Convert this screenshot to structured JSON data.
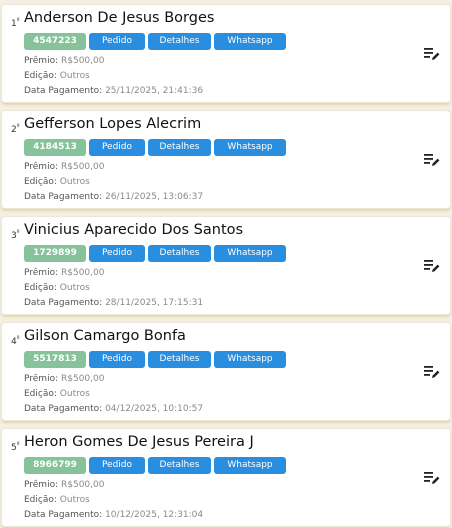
{
  "labels": {
    "premio": "Prêmio:",
    "edicao": "Edição:",
    "data_pagamento": "Data Pagamento:",
    "pedido": "Pedido",
    "detalhes": "Detalhes",
    "whatsapp": "Whatsapp"
  },
  "colors": {
    "id_chip": "#86c29a",
    "action_button": "#2a8ee0",
    "card_shadow": "#e8d9a8"
  },
  "winners": [
    {
      "rank": "1",
      "rank_suffix": "º",
      "name": "Anderson De Jesus Borges",
      "id": "4547223",
      "premio": "R$500,00",
      "edicao": "Outros",
      "data_pagamento": "25/11/2025, 21:41:36"
    },
    {
      "rank": "2",
      "rank_suffix": "º",
      "name": "Gefferson Lopes Alecrim",
      "id": "4184513",
      "premio": "R$500,00",
      "edicao": "Outros",
      "data_pagamento": "26/11/2025, 13:06:37"
    },
    {
      "rank": "3",
      "rank_suffix": "º",
      "name": "Vinicius Aparecido Dos Santos",
      "id": "1729899",
      "premio": "R$500,00",
      "edicao": "Outros",
      "data_pagamento": "28/11/2025, 17:15:31"
    },
    {
      "rank": "4",
      "rank_suffix": "º",
      "name": "Gilson Camargo Bonfa",
      "id": "5517813",
      "premio": "R$500,00",
      "edicao": "Outros",
      "data_pagamento": "04/12/2025, 10:10:57"
    },
    {
      "rank": "5",
      "rank_suffix": "º",
      "name": "Heron Gomes De Jesus Pereira J",
      "id": "8966799",
      "premio": "R$500,00",
      "edicao": "Outros",
      "data_pagamento": "10/12/2025, 12:31:04"
    }
  ]
}
